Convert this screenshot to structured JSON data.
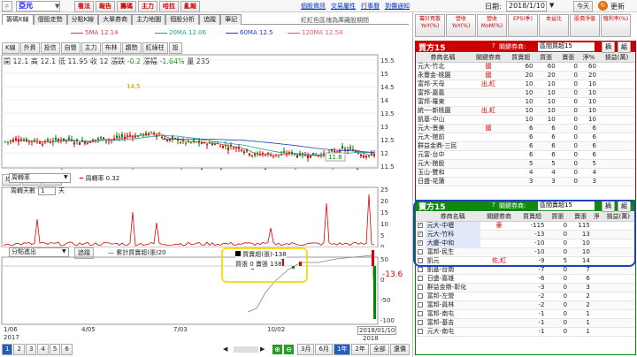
{
  "toolbar": {
    "stock": "亞元",
    "buttons": [
      "看法",
      "報告",
      "籌碼",
      "主力",
      "哈拉",
      "亂報"
    ],
    "links": [
      "個股資訊",
      "交易屬性",
      "行事曆",
      "到價通知"
    ],
    "date_label": "日期:",
    "date": "2018/1/10",
    "today": "今天",
    "refresh": "更新"
  },
  "tabs": [
    "籌碼K線",
    "個股走勢",
    "分點K線",
    "大單券商",
    "主力地圖",
    "個股分析",
    "追蹤",
    "筆記"
  ],
  "notice": "紅紅色區塊為庫藏股期間",
  "ma": [
    {
      "label": "5MA",
      "value": "12.14",
      "color": "#d04040"
    },
    {
      "label": "20MA",
      "value": "12.06",
      "color": "#20a0a0"
    },
    {
      "label": "60MA",
      "value": "12.5",
      "color": "#2040c0"
    },
    {
      "label": "120MA",
      "value": "12.54",
      "color": "#e06060"
    }
  ],
  "chart_tabs": [
    "K線",
    "外資",
    "投信",
    "自營",
    "主力",
    "布林",
    "趨勢",
    "紅綠柱",
    "設"
  ],
  "ohlc": {
    "open_label": "開",
    "open": "12.1",
    "high_label": "高",
    "high": "12.1",
    "low_label": "低",
    "low": "11.95",
    "close_label": "收",
    "close": "12",
    "chg_label": "漲跌",
    "chg": "-0.2",
    "pct_label": "漲幅",
    "pct": "-1.64%",
    "vol_label": "量",
    "vol": "235"
  },
  "price_axis": [
    "15.5",
    "15",
    "14.5",
    "14",
    "13.5",
    "13",
    "12.5",
    "12",
    "11.5"
  ],
  "mark_high": "14.5",
  "mark_low": "11.8",
  "tools": [
    "均線",
    "週均",
    "月均"
  ],
  "turnover": {
    "select": "周轉率",
    "legend": "周轉率 0.32",
    "days_label": "周轉天數",
    "days": "1",
    "unit": "天",
    "axis": [
      "25",
      "20",
      "15",
      "10",
      "5",
      "0"
    ]
  },
  "net": {
    "select": "分點進出",
    "track": "追蹤",
    "legend": "累計買賣超(張)20",
    "axis": [
      "50",
      "0",
      "-50",
      "-100"
    ],
    "last": "-13.6"
  },
  "tooltip": {
    "title": "買賣超(張)-138",
    "buy_label": "買張",
    "buy": "0",
    "sell_label": "賣張",
    "sell": "138"
  },
  "dates": [
    "1/06",
    "4/05",
    "7/03",
    "10/02",
    "2018/01/10"
  ],
  "year_start": "2017",
  "year_end": "2018",
  "pager": [
    "1",
    "2",
    "3",
    "4",
    "5",
    "6"
  ],
  "ranges": [
    "3月",
    "6月",
    "1年",
    "2年",
    "全部",
    "還價"
  ],
  "right_top_tabs": [
    "籌計買散YoY(%)",
    "營收YoY(%)",
    "營收MoM(%)",
    "EPS(季)",
    "本益比",
    "股價淨值",
    "殖利率(%)"
  ],
  "buy15": {
    "title": "買方15",
    "key_label": "關鍵券商:",
    "key": "區間買超15",
    "btn1": "摘",
    "btn2": "組",
    "headers": [
      "券商名稱",
      "關鍵券商",
      "買賣超",
      "買張",
      "賣張",
      "淨%",
      "損益(萬)"
    ],
    "rows": [
      [
        "元大-竹北",
        "國",
        "60",
        "60",
        "0",
        "60",
        ""
      ],
      [
        "永豐金-桃園",
        "國",
        "20",
        "20",
        "0",
        "20",
        ""
      ],
      [
        "富邦-天母",
        "出,紅",
        "10",
        "10",
        "0",
        "10",
        ""
      ],
      [
        "富邦-嘉義",
        "",
        "10",
        "10",
        "0",
        "10",
        ""
      ],
      [
        "富邦-羅東",
        "",
        "10",
        "10",
        "0",
        "10",
        ""
      ],
      [
        "統一-新桃園",
        "出,紅",
        "10",
        "10",
        "0",
        "10",
        ""
      ],
      [
        "凱基-中山",
        "",
        "10",
        "10",
        "0",
        "10",
        ""
      ],
      [
        "元大-景美",
        "國",
        "6",
        "6",
        "0",
        "6",
        ""
      ],
      [
        "元大-館前",
        "",
        "6",
        "6",
        "0",
        "6",
        ""
      ],
      [
        "群益金鼎-三民",
        "",
        "6",
        "6",
        "0",
        "6",
        ""
      ],
      [
        "元富-台中",
        "",
        "6",
        "6",
        "0",
        "6",
        ""
      ],
      [
        "元大-館股",
        "",
        "5",
        "5",
        "0",
        "5",
        ""
      ],
      [
        "玉山-雙和",
        "",
        "4",
        "4",
        "0",
        "4",
        ""
      ],
      [
        "日盛-花蓮",
        "",
        "3",
        "3",
        "0",
        "3",
        ""
      ]
    ]
  },
  "sell15": {
    "title": "賣方15",
    "key_label": "關鍵券商:",
    "key": "區間賣超15",
    "btn1": "摘",
    "btn2": "組",
    "headers": [
      "券商名稱",
      "關鍵券商",
      "買賣超",
      "買張",
      "賣張",
      "淨",
      "損益(萬)"
    ],
    "rows": [
      [
        "元大-中壢",
        "豪",
        "-115",
        "0",
        "115",
        ""
      ],
      [
        "元大-竹科",
        "",
        "-13",
        "0",
        "13",
        ""
      ],
      [
        "大慶-中和",
        "",
        "-10",
        "0",
        "10",
        ""
      ],
      [
        "富邦-民生",
        "",
        "-10",
        "0",
        "10",
        ""
      ],
      [
        "凱元",
        "佐,紅",
        "-9",
        "5",
        "14",
        ""
      ],
      [
        "凱基-台南",
        "",
        "-7",
        "0",
        "7",
        ""
      ],
      [
        "日盛-嘉雄",
        "",
        "-6",
        "0",
        "6",
        ""
      ],
      [
        "群益金鼎-彰化",
        "",
        "-3",
        "0",
        "3",
        ""
      ],
      [
        "富邦-左營",
        "",
        "-2",
        "0",
        "2",
        ""
      ],
      [
        "富邦-員林",
        "",
        "-2",
        "0",
        "2",
        ""
      ],
      [
        "富邦-南屯",
        "",
        "-1",
        "0",
        "1",
        ""
      ],
      [
        "富邦-基吉",
        "",
        "-1",
        "0",
        "1",
        ""
      ],
      [
        "元大-南屯",
        "",
        "-1",
        "0",
        "1",
        ""
      ]
    ]
  }
}
